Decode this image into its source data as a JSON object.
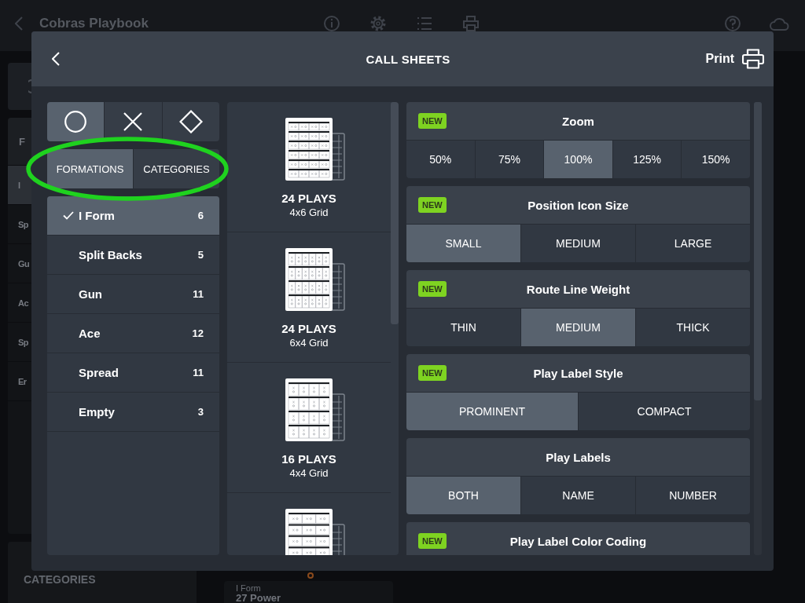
{
  "backdrop": {
    "app_title": "Cobras Playbook",
    "sidebar": {
      "heading": "F",
      "items": [
        {
          "label": "I",
          "selected": true
        },
        {
          "label": "Sp",
          "selected": false
        },
        {
          "label": "Gu",
          "selected": false
        },
        {
          "label": "Ac",
          "selected": false
        },
        {
          "label": "Sp",
          "selected": false
        },
        {
          "label": "Er",
          "selected": false
        }
      ],
      "footer": "CATEGORIES"
    },
    "card": {
      "subtitle": "I Form",
      "title": "27 Power"
    }
  },
  "dialog": {
    "title": "CALL SHEETS",
    "print_label": "Print"
  },
  "shape_tabs": [
    {
      "kind": "circle",
      "selected": true
    },
    {
      "kind": "cross",
      "selected": false
    },
    {
      "kind": "diamond",
      "selected": false
    }
  ],
  "source_tabs": {
    "circled": true,
    "items": [
      {
        "label": "FORMATIONS",
        "selected": true
      },
      {
        "label": "CATEGORIES",
        "selected": false
      }
    ]
  },
  "formations": [
    {
      "name": "I Form",
      "count": "6",
      "selected": true
    },
    {
      "name": "Split Backs",
      "count": "5",
      "selected": false
    },
    {
      "name": "Gun",
      "count": "11",
      "selected": false
    },
    {
      "name": "Ace",
      "count": "12",
      "selected": false
    },
    {
      "name": "Spread",
      "count": "11",
      "selected": false
    },
    {
      "name": "Empty",
      "count": "3",
      "selected": false
    }
  ],
  "layouts": [
    {
      "kind": "cols4rows6",
      "title": "24 PLAYS",
      "subtitle": "4x6 Grid"
    },
    {
      "kind": "cols6rows4",
      "title": "24 PLAYS",
      "subtitle": "6x4 Grid"
    },
    {
      "kind": "cols4rows4",
      "title": "16 PLAYS",
      "subtitle": "4x4 Grid"
    },
    {
      "kind": "cols3rows5"
    }
  ],
  "settings": [
    {
      "title": "Zoom",
      "badge": "NEW",
      "options": [
        {
          "label": "50%",
          "selected": false
        },
        {
          "label": "75%",
          "selected": false
        },
        {
          "label": "100%",
          "selected": true
        },
        {
          "label": "125%",
          "selected": false
        },
        {
          "label": "150%",
          "selected": false
        }
      ]
    },
    {
      "title": "Position Icon Size",
      "badge": "NEW",
      "options": [
        {
          "label": "SMALL",
          "selected": true
        },
        {
          "label": "MEDIUM",
          "selected": false
        },
        {
          "label": "LARGE",
          "selected": false
        }
      ]
    },
    {
      "title": "Route Line Weight",
      "badge": "NEW",
      "options": [
        {
          "label": "THIN",
          "selected": false
        },
        {
          "label": "MEDIUM",
          "selected": true
        },
        {
          "label": "THICK",
          "selected": false
        }
      ]
    },
    {
      "title": "Play Label Style",
      "badge": "NEW",
      "options": [
        {
          "label": "PROMINENT",
          "selected": true
        },
        {
          "label": "COMPACT",
          "selected": false
        }
      ]
    },
    {
      "title": "Play Labels",
      "options": [
        {
          "label": "BOTH",
          "selected": true
        },
        {
          "label": "NAME",
          "selected": false
        },
        {
          "label": "NUMBER",
          "selected": false
        }
      ]
    },
    {
      "title": "Play Label Color Coding",
      "badge": "NEW"
    }
  ]
}
